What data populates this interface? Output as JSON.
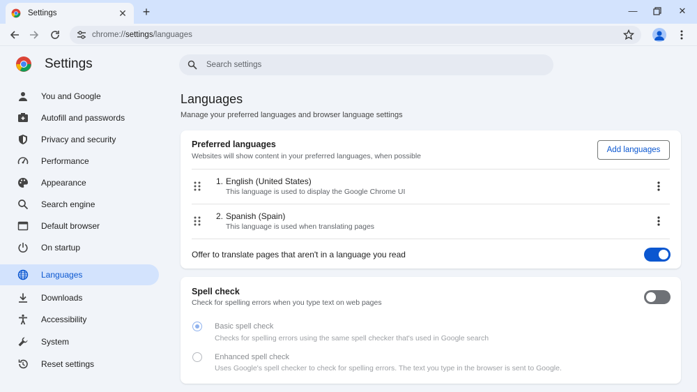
{
  "tab": {
    "title": "Settings"
  },
  "toolbar": {
    "url_scheme": "chrome://",
    "url_host": "settings",
    "url_path": "/languages"
  },
  "brand": {
    "title": "Settings"
  },
  "search": {
    "placeholder": "Search settings"
  },
  "sidebar": {
    "items": [
      {
        "label": "You and Google",
        "icon": "person-icon"
      },
      {
        "label": "Autofill and passwords",
        "icon": "autofill-icon"
      },
      {
        "label": "Privacy and security",
        "icon": "shield-icon"
      },
      {
        "label": "Performance",
        "icon": "speedometer-icon"
      },
      {
        "label": "Appearance",
        "icon": "palette-icon"
      },
      {
        "label": "Search engine",
        "icon": "search-icon"
      },
      {
        "label": "Default browser",
        "icon": "browser-window-icon"
      },
      {
        "label": "On startup",
        "icon": "power-icon"
      },
      {
        "label": "Languages",
        "icon": "globe-icon",
        "active": true
      },
      {
        "label": "Downloads",
        "icon": "download-icon"
      },
      {
        "label": "Accessibility",
        "icon": "accessibility-icon"
      },
      {
        "label": "System",
        "icon": "wrench-icon"
      },
      {
        "label": "Reset settings",
        "icon": "reset-icon"
      }
    ]
  },
  "main": {
    "title": "Languages",
    "subtitle": "Manage your preferred languages and browser language settings",
    "preferred": {
      "heading": "Preferred languages",
      "description": "Websites will show content in your preferred languages, when possible",
      "add_button": "Add languages",
      "languages": [
        {
          "number": "1.",
          "name": "English (United States)",
          "note": "This language is used to display the Google Chrome UI"
        },
        {
          "number": "2.",
          "name": "Spanish (Spain)",
          "note": "This language is used when translating pages"
        }
      ],
      "offer_translate": {
        "label": "Offer to translate pages that aren't in a language you read",
        "enabled": true
      }
    },
    "spellcheck": {
      "heading": "Spell check",
      "description": "Check for spelling errors when you type text on web pages",
      "enabled": false,
      "options": [
        {
          "label": "Basic spell check",
          "note": "Checks for spelling errors using the same spell checker that's used in Google search",
          "selected": true
        },
        {
          "label": "Enhanced spell check",
          "note": "Uses Google's spell checker to check for spelling errors. The text you type in the browser is sent to Google.",
          "selected": false
        }
      ]
    }
  },
  "colors": {
    "accent": "#0b57d0",
    "active_nav_bg": "#d3e3fd",
    "page_bg": "#f1f4f9"
  }
}
